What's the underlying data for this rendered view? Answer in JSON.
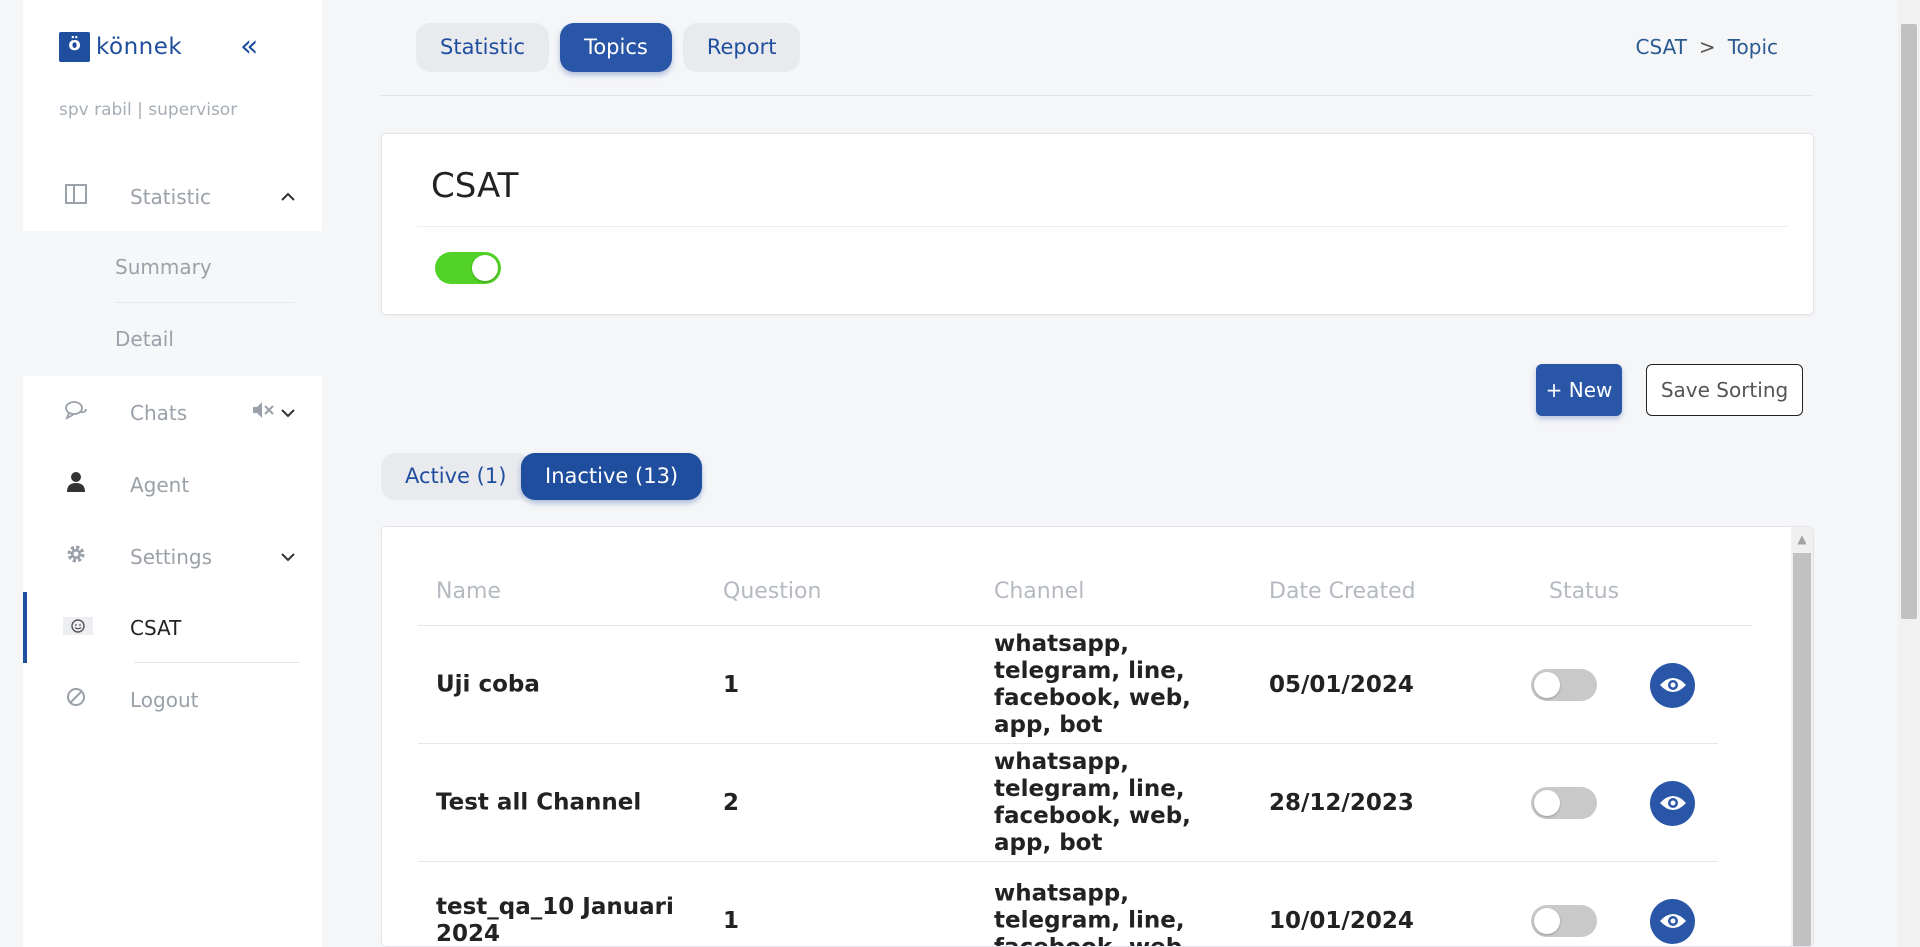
{
  "brand": {
    "logo_letter": "ö",
    "name": "könnek"
  },
  "sidebar": {
    "collapse_glyph": "«",
    "user": "spv rabil | supervisor",
    "items": [
      {
        "label": "Statistic",
        "icon": "layout-icon"
      },
      {
        "label": "Chats",
        "icon": "chat-icon"
      },
      {
        "label": "Agent",
        "icon": "user-icon"
      },
      {
        "label": "Settings",
        "icon": "gear-icon"
      },
      {
        "label": "CSAT",
        "icon": "smile-icon"
      },
      {
        "label": "Logout",
        "icon": "logout-icon"
      }
    ],
    "statistic_sub": [
      "Summary",
      "Detail"
    ]
  },
  "top_tabs": [
    "Statistic",
    "Topics",
    "Report"
  ],
  "active_tab": "Topics",
  "breadcrumb": {
    "first": "CSAT",
    "separator": ">",
    "second": "Topic"
  },
  "card": {
    "title": "CSAT",
    "enabled": true
  },
  "actions": {
    "new_label": "+ New",
    "save_label": "Save Sorting"
  },
  "filters": {
    "active": "Active (1)",
    "inactive": "Inactive (13)"
  },
  "table": {
    "headers": [
      "Name",
      "Question",
      "Channel",
      "Date Created",
      "Status"
    ],
    "rows": [
      {
        "name": "Uji coba",
        "question": "1",
        "channel": "whatsapp, telegram, line, facebook, web, app, bot",
        "date": "05/01/2024",
        "status": false
      },
      {
        "name": "Test all Channel",
        "question": "2",
        "channel": "whatsapp, telegram, line, facebook, web, app, bot",
        "date": "28/12/2023",
        "status": false
      },
      {
        "name": "test_qa_10 Januari 2024",
        "question": "1",
        "channel": "whatsapp, telegram, line, facebook, web,",
        "date": "10/01/2024",
        "status": false
      }
    ]
  },
  "colors": {
    "primary": "#2a56a8",
    "toggle_on": "#52d126",
    "toggle_off": "#c9c9c9"
  }
}
